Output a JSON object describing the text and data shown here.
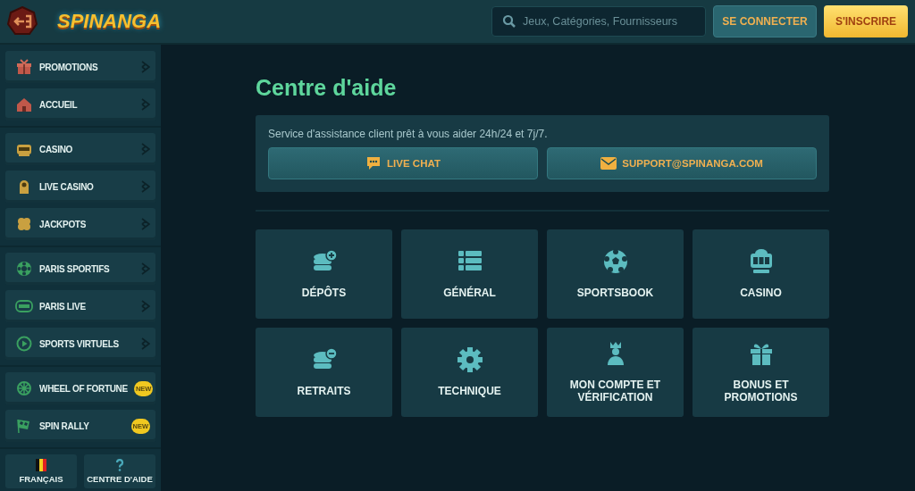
{
  "header": {
    "logo": "SPINANGA",
    "search": {
      "placeholder": "Jeux, Catégories, Fournisseurs"
    },
    "buttons": [
      {
        "label": "SE CONNECTER",
        "kind": "secondary"
      },
      {
        "label": "S'INSCRIRE",
        "kind": "primary"
      }
    ]
  },
  "sidebar": {
    "groups": [
      {
        "items": [
          {
            "label": "PROMOTIONS"
          },
          {
            "label": "ACCUEIL"
          }
        ]
      },
      {
        "items": [
          {
            "label": "CASINO"
          },
          {
            "label": "LIVE CASINO"
          },
          {
            "label": "JACKPOTS"
          }
        ]
      },
      {
        "items": [
          {
            "label": "PARIS SPORTIFS"
          },
          {
            "label": "PARIS LIVE"
          },
          {
            "label": "SPORTS VIRTUELS"
          }
        ]
      },
      {
        "items": [
          {
            "label": "WHEEL OF FORTUNE",
            "badge": "NEW"
          },
          {
            "label": "SPIN RALLY",
            "badge": "NEW"
          }
        ]
      }
    ],
    "footer": [
      {
        "label": "FRANÇAIS"
      },
      {
        "label": "CENTRE D'AIDE"
      }
    ]
  },
  "main": {
    "title": "Centre d'aide",
    "support": {
      "text": "Service d'assistance client prêt à vous aider 24h/24 et 7j/7.",
      "buttons": [
        {
          "label": "LIVE CHAT"
        },
        {
          "label": "SUPPORT@SPINANGA.COM"
        }
      ]
    },
    "categories": [
      {
        "label": "DÉPÔTS"
      },
      {
        "label": "GÉNÉRAL"
      },
      {
        "label": "SPORTSBOOK"
      },
      {
        "label": "CASINO"
      },
      {
        "label": "RETRAITS"
      },
      {
        "label": "TECHNIQUE"
      },
      {
        "label": "MON COMPTE ET VÉRIFICATION"
      },
      {
        "label": "BONUS ET PROMOTIONS"
      }
    ]
  }
}
